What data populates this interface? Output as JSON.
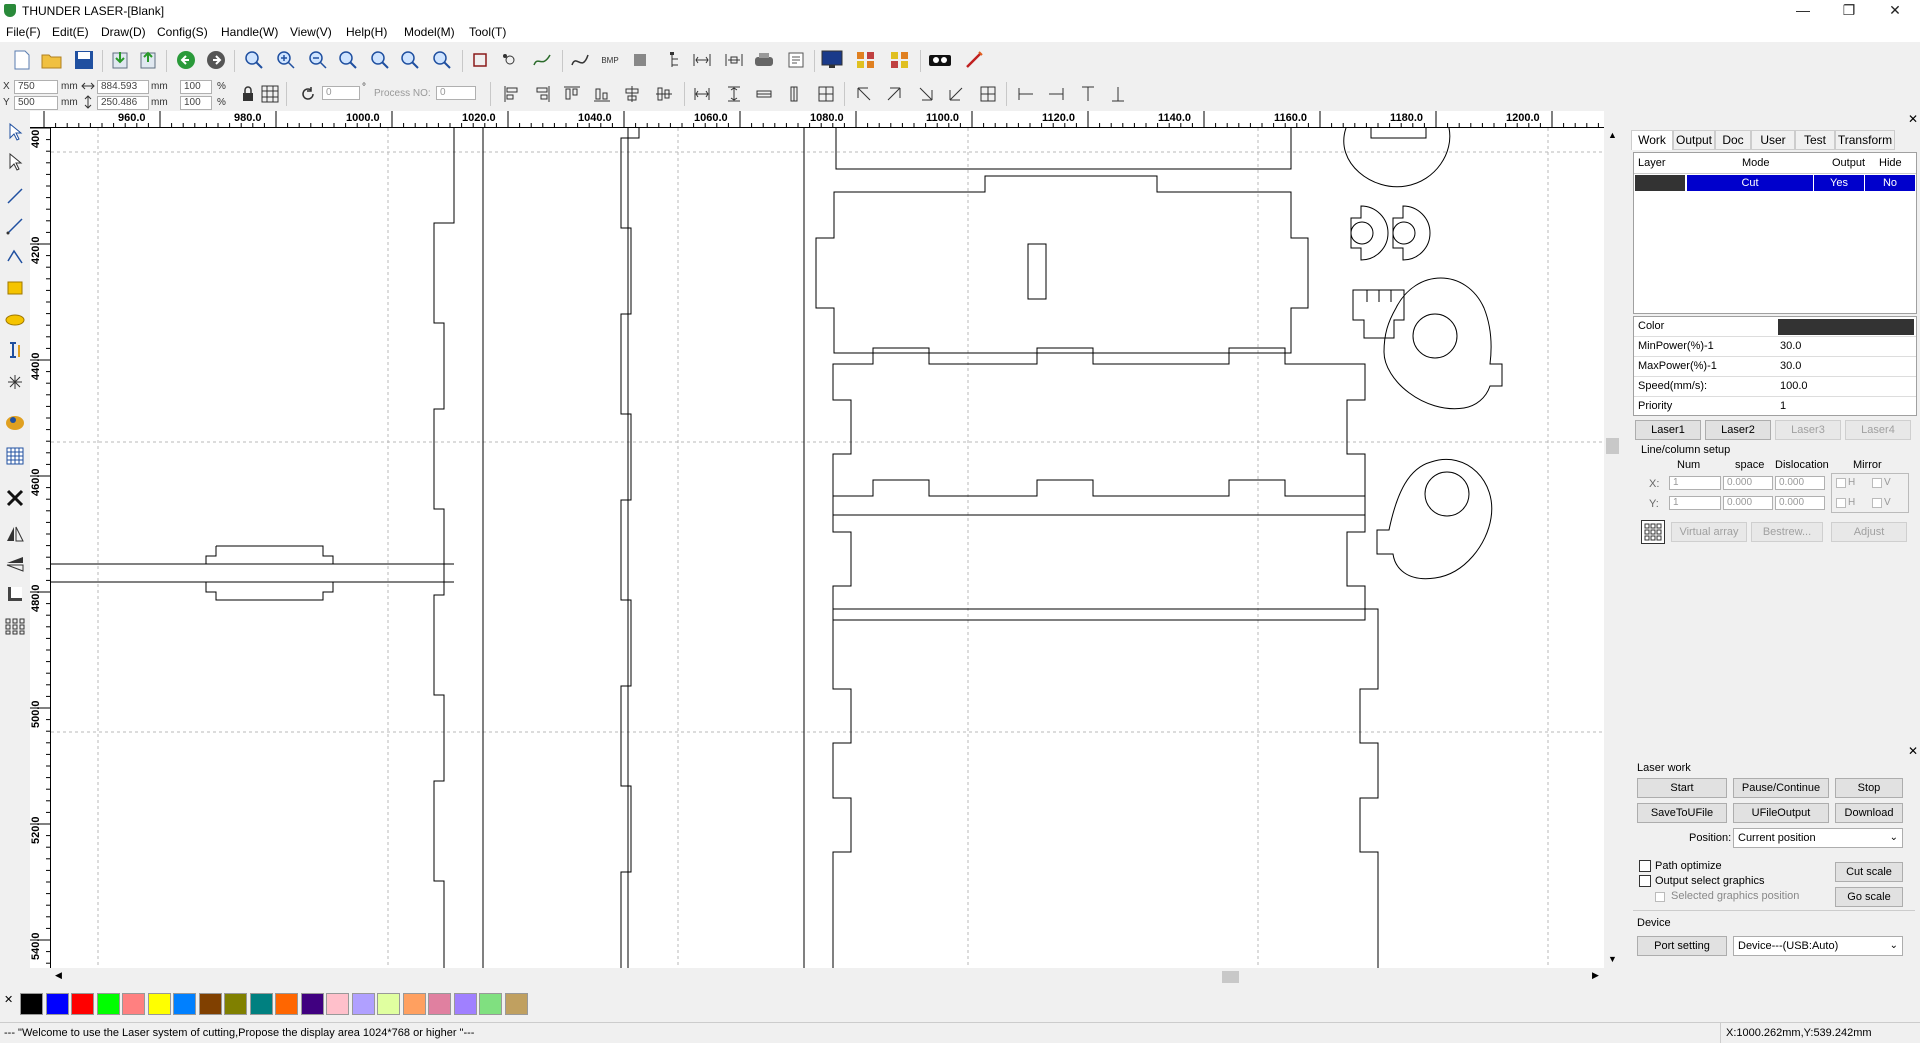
{
  "window": {
    "title": "THUNDER LASER-[Blank]"
  },
  "menu": [
    "File(F)",
    "Edit(E)",
    "Draw(D)",
    "Config(S)",
    "Handle(W)",
    "View(V)",
    "Help(H)",
    "Model(M)",
    "Tool(T)"
  ],
  "coords": {
    "x_label": "X",
    "x_value": "750",
    "x_unit": "mm",
    "y_label": "Y",
    "y_value": "500",
    "y_unit": "mm",
    "w_value": "884.593",
    "w_unit": "mm",
    "h_value": "250.486",
    "h_unit": "mm",
    "sx_value": "100",
    "sx_unit": "%",
    "sy_value": "100",
    "sy_unit": "%",
    "rotate_value": "0",
    "rotate_unit": "°",
    "process_label": "Process NO:",
    "process_value": "0"
  },
  "ruler_h": [
    "960.0",
    "980.0",
    "1000.0",
    "1020.0",
    "1040.0",
    "1060.0",
    "1080.0",
    "1100.0",
    "1120.0",
    "1140.0",
    "1160.0",
    "1180.0",
    "1200.0"
  ],
  "ruler_v": [
    "400",
    "420.0",
    "440.0",
    "460.0",
    "480.0",
    "500.0",
    "520.0",
    "540.0"
  ],
  "panel": {
    "tabs": [
      "Work",
      "Output",
      "Doc",
      "User",
      "Test",
      "Transform"
    ],
    "layer_headers": [
      "Layer",
      "Mode",
      "Output",
      "Hide"
    ],
    "layer_row": {
      "mode": "Cut",
      "output": "Yes",
      "hide": "No",
      "color": "#333333"
    },
    "props": [
      {
        "label": "Color",
        "value": ""
      },
      {
        "label": "MinPower(%)-1",
        "value": "30.0"
      },
      {
        "label": "MaxPower(%)-1",
        "value": "30.0"
      },
      {
        "label": "Speed(mm/s):",
        "value": "100.0"
      },
      {
        "label": "Priority",
        "value": "1"
      }
    ],
    "lasers": [
      "Laser1",
      "Laser2",
      "Laser3",
      "Laser4"
    ],
    "array": {
      "title": "Line/column setup",
      "headers": [
        "Num",
        "space",
        "Dislocation",
        "Mirror"
      ],
      "x_label": "X:",
      "y_label": "Y:",
      "x_num": "1",
      "x_space": "0.000",
      "x_disl": "0.000",
      "y_num": "1",
      "y_space": "0.000",
      "y_disl": "0.000",
      "h": "H",
      "v": "V",
      "virtual_array": "Virtual array",
      "bestrew": "Bestrew...",
      "adjust": "Adjust"
    }
  },
  "laser_work": {
    "title": "Laser work",
    "start": "Start",
    "pause": "Pause/Continue",
    "stop": "Stop",
    "save_ufile": "SaveToUFile",
    "ufile_output": "UFileOutput",
    "download": "Download",
    "position_label": "Position:",
    "position_value": "Current position",
    "path_optimize": "Path optimize",
    "output_select": "Output select graphics",
    "selected_pos": "Selected graphics position",
    "cut_scale": "Cut scale",
    "go_scale": "Go scale",
    "device_title": "Device",
    "port_setting": "Port setting",
    "device_value": "Device---(USB:Auto)"
  },
  "palette": [
    "#000000",
    "#0000ff",
    "#ff0000",
    "#00ff00",
    "#ff8080",
    "#ffff00",
    "#0080ff",
    "#804000",
    "#808000",
    "#008080",
    "#ff6600",
    "#400080",
    "#ffc0cb",
    "#b0a0ff",
    "#e0ffa0",
    "#ffa060",
    "#e080a0",
    "#a080ff",
    "#80e080",
    "#c0a060"
  ],
  "status": {
    "message": "--- \"Welcome to use the Laser system of cutting,Propose the display area 1024*768 or higher \"---",
    "coords": "X:1000.262mm,Y:539.242mm"
  }
}
